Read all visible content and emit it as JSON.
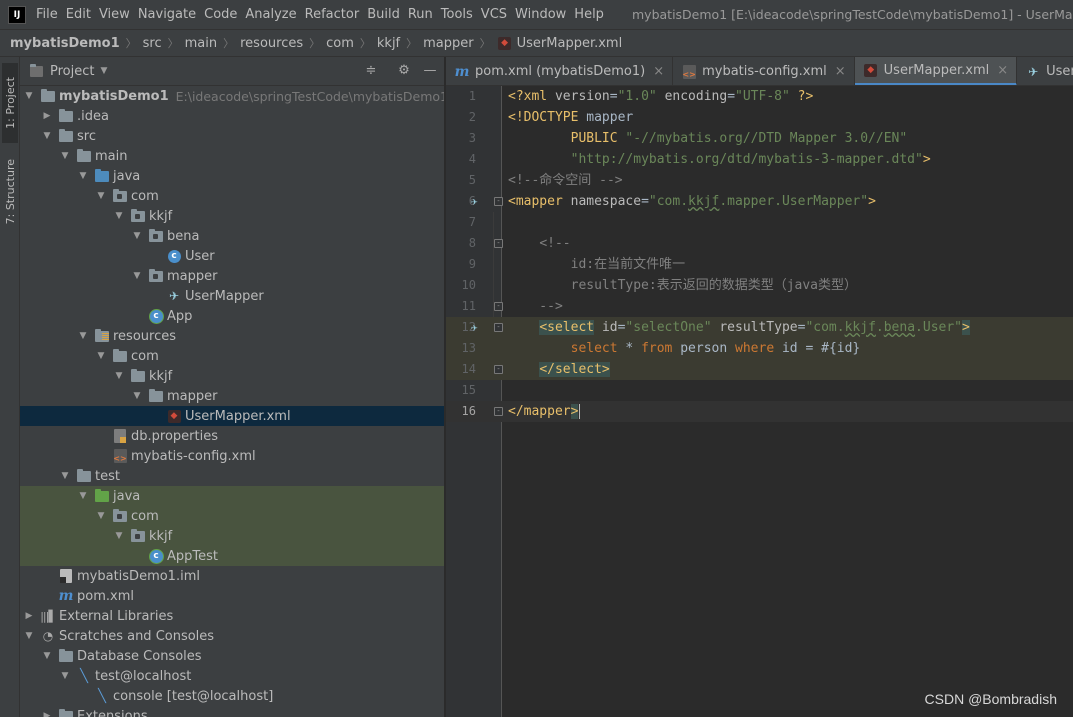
{
  "menubar": {
    "logo": "IJ",
    "items": [
      "File",
      "Edit",
      "View",
      "Navigate",
      "Code",
      "Analyze",
      "Refactor",
      "Build",
      "Run",
      "Tools",
      "VCS",
      "Window",
      "Help"
    ],
    "window_title": "mybatisDemo1 [E:\\ideacode\\springTestCode\\mybatisDemo1] - UserMapper.xml"
  },
  "breadcrumb": [
    "mybatisDemo1",
    "src",
    "main",
    "resources",
    "com",
    "kkjf",
    "mapper",
    "UserMapper.xml"
  ],
  "tool_stripe": {
    "project_tab": "1: Project",
    "structure_tab": "7: Structure"
  },
  "project_panel": {
    "title": "Project",
    "tree": [
      {
        "label": "mybatisDemo1",
        "sub": "E:\\ideacode\\springTestCode\\mybatisDemo1",
        "depth": 0,
        "arrow": "open",
        "icon": "folder"
      },
      {
        "label": ".idea",
        "depth": 1,
        "arrow": "closed",
        "icon": "folder"
      },
      {
        "label": "src",
        "depth": 1,
        "arrow": "open",
        "icon": "folder"
      },
      {
        "label": "main",
        "depth": 2,
        "arrow": "open",
        "icon": "folder"
      },
      {
        "label": "java",
        "depth": 3,
        "arrow": "open",
        "icon": "folder-blue"
      },
      {
        "label": "com",
        "depth": 4,
        "arrow": "open",
        "icon": "package"
      },
      {
        "label": "kkjf",
        "depth": 5,
        "arrow": "open",
        "icon": "package"
      },
      {
        "label": "bena",
        "depth": 6,
        "arrow": "open",
        "icon": "package"
      },
      {
        "label": "User",
        "depth": 7,
        "arrow": "none",
        "icon": "class"
      },
      {
        "label": "mapper",
        "depth": 6,
        "arrow": "open",
        "icon": "package"
      },
      {
        "label": "UserMapper",
        "depth": 7,
        "arrow": "none",
        "icon": "mybatis-bird"
      },
      {
        "label": "App",
        "depth": 6,
        "arrow": "none",
        "icon": "class-runnable"
      },
      {
        "label": "resources",
        "depth": 3,
        "arrow": "open",
        "icon": "folder-resources"
      },
      {
        "label": "com",
        "depth": 4,
        "arrow": "open",
        "icon": "folder"
      },
      {
        "label": "kkjf",
        "depth": 5,
        "arrow": "open",
        "icon": "folder"
      },
      {
        "label": "mapper",
        "depth": 6,
        "arrow": "open",
        "icon": "folder"
      },
      {
        "label": "UserMapper.xml",
        "depth": 7,
        "arrow": "none",
        "icon": "xml-file",
        "selected": true
      },
      {
        "label": "db.properties",
        "depth": 4,
        "arrow": "none",
        "icon": "properties-file"
      },
      {
        "label": "mybatis-config.xml",
        "depth": 4,
        "arrow": "none",
        "icon": "config-file"
      },
      {
        "label": "test",
        "depth": 2,
        "arrow": "open",
        "icon": "folder"
      },
      {
        "label": "java",
        "depth": 3,
        "arrow": "open",
        "icon": "folder-green",
        "test": true
      },
      {
        "label": "com",
        "depth": 4,
        "arrow": "open",
        "icon": "package",
        "test": true
      },
      {
        "label": "kkjf",
        "depth": 5,
        "arrow": "open",
        "icon": "package",
        "test": true
      },
      {
        "label": "AppTest",
        "depth": 6,
        "arrow": "none",
        "icon": "class-runnable",
        "test": true
      },
      {
        "label": "mybatisDemo1.iml",
        "depth": 1,
        "arrow": "none",
        "icon": "iml-file"
      },
      {
        "label": "pom.xml",
        "depth": 1,
        "arrow": "none",
        "icon": "maven-file"
      },
      {
        "label": "External Libraries",
        "depth": 0,
        "arrow": "closed",
        "icon": "libraries"
      },
      {
        "label": "Scratches and Consoles",
        "depth": 0,
        "arrow": "open",
        "icon": "scratches"
      },
      {
        "label": "Database Consoles",
        "depth": 1,
        "arrow": "open",
        "icon": "folder"
      },
      {
        "label": "test@localhost",
        "depth": 2,
        "arrow": "open",
        "icon": "db-console"
      },
      {
        "label": "console [test@localhost]",
        "depth": 3,
        "arrow": "none",
        "icon": "db-console"
      },
      {
        "label": "Extensions",
        "depth": 1,
        "arrow": "closed",
        "icon": "folder"
      }
    ]
  },
  "editor_tabs": [
    {
      "label": "pom.xml (mybatisDemo1)",
      "icon": "maven-file",
      "closable": true,
      "active": false
    },
    {
      "label": "mybatis-config.xml",
      "icon": "config-file",
      "closable": true,
      "active": false
    },
    {
      "label": "UserMapper.xml",
      "icon": "xml-file",
      "closable": true,
      "active": true
    },
    {
      "label": "UserMapper.java",
      "icon": "mybatis-bird",
      "closable": false,
      "active": false
    }
  ],
  "editor": {
    "lines": [
      {
        "n": "1",
        "tokens": [
          [
            "t-tag",
            "<?xml "
          ],
          [
            "t-attr",
            "version"
          ],
          [
            "t-plain",
            "="
          ],
          [
            "t-val",
            "\"1.0\""
          ],
          [
            "t-plain",
            " "
          ],
          [
            "t-attr",
            "encoding"
          ],
          [
            "t-plain",
            "="
          ],
          [
            "t-val",
            "\"UTF-8\""
          ],
          [
            "t-tag",
            " ?>"
          ]
        ]
      },
      {
        "n": "2",
        "tokens": [
          [
            "t-tag",
            "<!DOCTYPE "
          ],
          [
            "t-plain",
            "mapper"
          ]
        ]
      },
      {
        "n": "3",
        "tokens": [
          [
            "t-plain",
            "        "
          ],
          [
            "t-tag",
            "PUBLIC "
          ],
          [
            "t-val",
            "\"-//mybatis.org//DTD Mapper 3.0//EN\""
          ]
        ]
      },
      {
        "n": "4",
        "tokens": [
          [
            "t-plain",
            "        "
          ],
          [
            "t-val",
            "\"http://mybatis.org/dtd/mybatis-3-mapper.dtd\""
          ],
          [
            "t-tag",
            ">"
          ]
        ]
      },
      {
        "n": "5",
        "tokens": [
          [
            "t-comment",
            "<!--命令空间 -->"
          ]
        ]
      },
      {
        "n": "6",
        "gicon": true,
        "fold": true,
        "tokens": [
          [
            "t-tag",
            "<mapper "
          ],
          [
            "t-attr",
            "namespace"
          ],
          [
            "t-plain",
            "="
          ],
          [
            "t-val",
            "\"com."
          ],
          [
            "t-val wavy",
            "kkjf"
          ],
          [
            "t-val",
            ".mapper.UserMapper\""
          ],
          [
            "t-tag",
            ">"
          ]
        ]
      },
      {
        "n": "7",
        "tokens": []
      },
      {
        "n": "8",
        "fold": true,
        "tokens": [
          [
            "t-plain",
            "    "
          ],
          [
            "t-comment",
            "<!--"
          ]
        ]
      },
      {
        "n": "9",
        "tokens": [
          [
            "t-comment",
            "        id:在当前文件唯一"
          ]
        ]
      },
      {
        "n": "10",
        "tokens": [
          [
            "t-comment",
            "        resultType:表示返回的数据类型（java类型）"
          ]
        ]
      },
      {
        "n": "11",
        "fold": true,
        "tokens": [
          [
            "t-comment",
            "    -->"
          ]
        ]
      },
      {
        "n": "12",
        "gicon": true,
        "fold": true,
        "hl": true,
        "tokens": [
          [
            "t-plain",
            "    "
          ],
          [
            "t-tag tag-hl",
            "<select"
          ],
          [
            "t-plain",
            " "
          ],
          [
            "t-attr",
            "id"
          ],
          [
            "t-plain",
            "="
          ],
          [
            "t-val",
            "\"selectOne\""
          ],
          [
            "t-plain",
            " "
          ],
          [
            "t-attr",
            "resultType"
          ],
          [
            "t-plain",
            "="
          ],
          [
            "t-val",
            "\"com."
          ],
          [
            "t-val wavy",
            "kkjf"
          ],
          [
            "t-val",
            "."
          ],
          [
            "t-val wavy",
            "bena"
          ],
          [
            "t-val",
            ".User\""
          ],
          [
            "t-tag tag-hl",
            ">"
          ]
        ]
      },
      {
        "n": "13",
        "hl": true,
        "tokens": [
          [
            "t-plain",
            "        "
          ],
          [
            "t-sqlkw",
            "select "
          ],
          [
            "t-plain",
            "* "
          ],
          [
            "t-sqlkw",
            "from "
          ],
          [
            "t-plain",
            "person "
          ],
          [
            "t-sqlkw",
            "where "
          ],
          [
            "t-plain",
            "id = #{id}"
          ]
        ]
      },
      {
        "n": "14",
        "fold": true,
        "hl": true,
        "tokens": [
          [
            "t-plain",
            "    "
          ],
          [
            "t-tag tag-hl",
            "</select>"
          ]
        ]
      },
      {
        "n": "15",
        "tokens": []
      },
      {
        "n": "16",
        "fold": true,
        "caret": true,
        "tokens": [
          [
            "t-tag",
            "</mapper"
          ],
          [
            "t-tag tag-hl",
            ">"
          ]
        ]
      }
    ]
  },
  "watermark": "CSDN @Bombradish"
}
